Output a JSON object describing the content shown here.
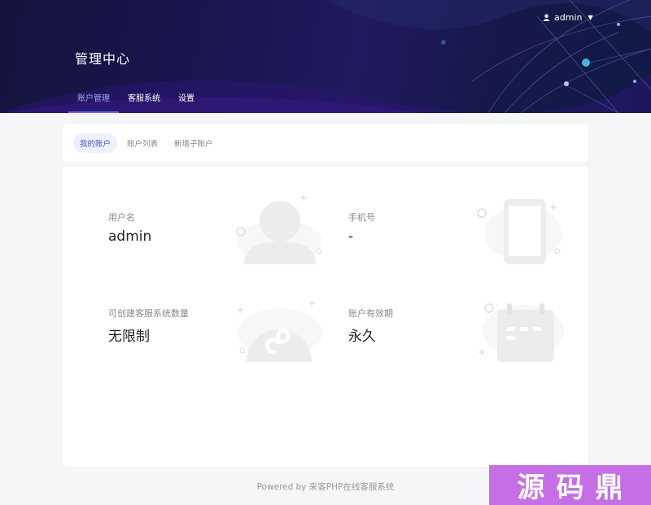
{
  "header": {
    "title": "管理中心",
    "user": {
      "name": "admin"
    },
    "nav": [
      {
        "label": "账户管理",
        "active": true
      },
      {
        "label": "客服系统",
        "active": false
      },
      {
        "label": "设置",
        "active": false
      }
    ]
  },
  "subnav": {
    "tabs": [
      {
        "label": "我的账户",
        "active": true
      },
      {
        "label": "账户列表",
        "active": false
      },
      {
        "label": "新增子账户",
        "active": false
      }
    ]
  },
  "account": {
    "username": {
      "label": "用户名",
      "value": "admin",
      "icon": "user-illustration-icon"
    },
    "phone": {
      "label": "手机号",
      "value": "-",
      "icon": "phone-illustration-icon"
    },
    "quota": {
      "label": "可创建客服系统数量",
      "value": "无限制",
      "icon": "miniprogram-illustration-icon"
    },
    "validity": {
      "label": "账户有效期",
      "value": "永久",
      "icon": "calendar-illustration-icon"
    }
  },
  "footer": {
    "text": "Powered by 来客PHP在线客服系统"
  },
  "watermark": {
    "chars": [
      "源",
      "码",
      "鼎"
    ]
  },
  "colors": {
    "header": "#1a1650",
    "accent": "#6c63ff",
    "watermark": "#c56ee6"
  }
}
